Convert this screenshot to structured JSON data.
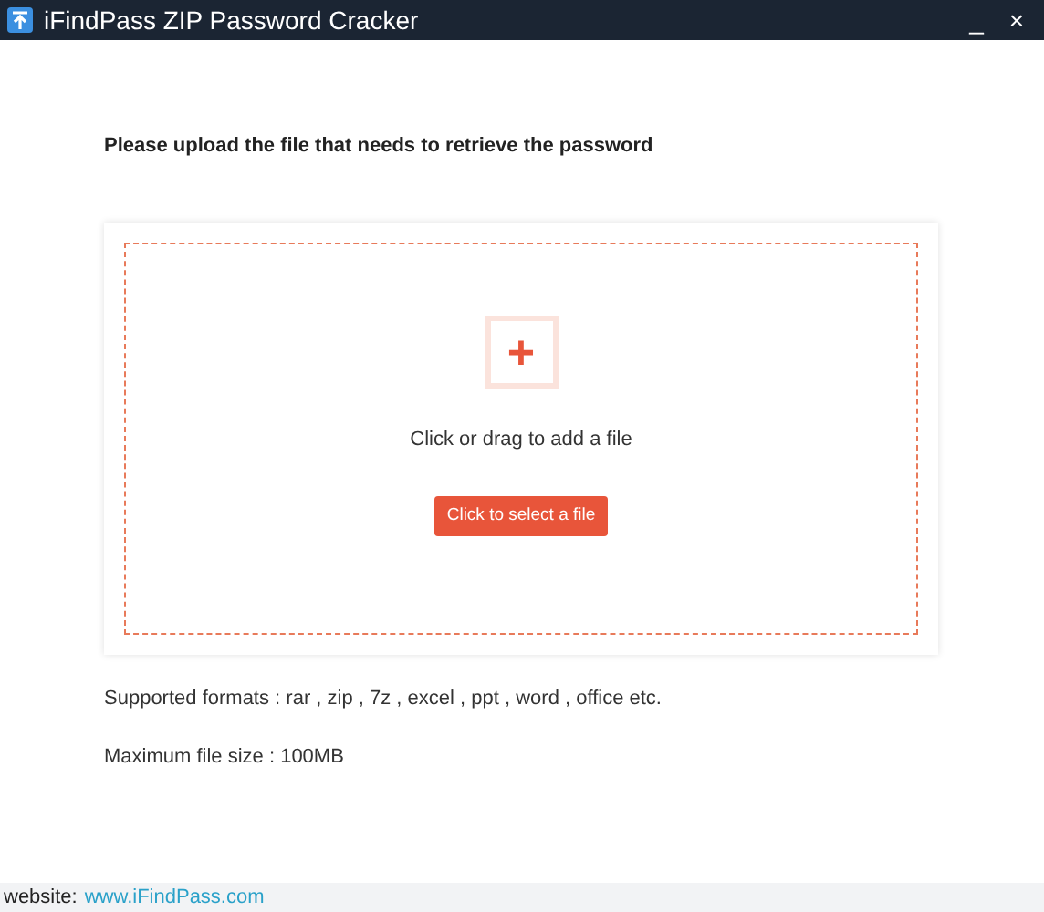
{
  "window": {
    "title": "iFindPass ZIP Password Cracker",
    "controls": [
      "_",
      "×"
    ]
  },
  "heading": "Please upload the file that needs to retrieve the password",
  "upload": {
    "icon_text": "+",
    "hint": "Click or drag to add a file",
    "button": "Click to select a file"
  },
  "notes": [
    "Supported formats : rar , zip , 7z , excel , ppt , word , office etc.",
    "Maximum file size :  100MB"
  ],
  "footer": {
    "label": "website:",
    "link": "www.iFindPass.com"
  }
}
